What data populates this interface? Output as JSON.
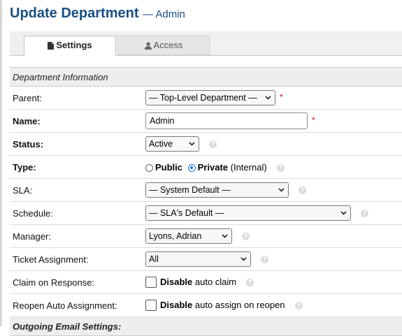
{
  "header": {
    "title": "Update Department",
    "subtitle": "— Admin"
  },
  "tabs": [
    {
      "label": "Settings",
      "icon": "document-icon",
      "active": true
    },
    {
      "label": "Access",
      "icon": "user-icon",
      "active": false
    }
  ],
  "sections": {
    "dept_info": "Department Information",
    "email": "Outgoing Email Settings:"
  },
  "fields": {
    "parent": {
      "label": "Parent:",
      "value": "— Top-Level Department —"
    },
    "name": {
      "label": "Name:",
      "value": "Admin"
    },
    "status": {
      "label": "Status:",
      "value": "Active"
    },
    "type": {
      "label": "Type:",
      "public": "Public",
      "private": "Private",
      "private_note": "(Internal)",
      "selected": "private"
    },
    "sla": {
      "label": "SLA:",
      "value": "— System Default —"
    },
    "schedule": {
      "label": "Schedule:",
      "value": "— SLA's Default —"
    },
    "manager": {
      "label": "Manager:",
      "value": "Lyons, Adrian"
    },
    "assignment": {
      "label": "Ticket Assignment:",
      "value": "All"
    },
    "claim": {
      "label": "Claim on Response:",
      "bold": "Disable",
      "rest": "auto claim"
    },
    "reopen": {
      "label": "Reopen Auto Assignment:",
      "bold": "Disable",
      "rest": "auto assign on reopen"
    }
  },
  "required_marker": "*",
  "colors": {
    "title": "#184e81",
    "required": "#d80000",
    "radio_selected": "#1a73e8"
  }
}
